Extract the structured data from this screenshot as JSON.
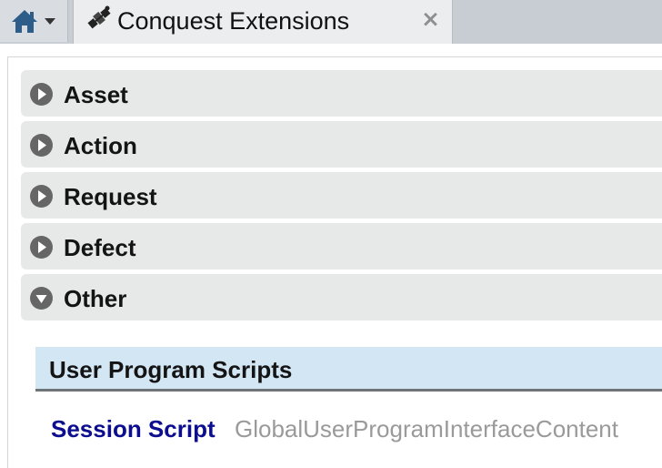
{
  "home": {
    "icon": "home-icon",
    "dropdown_icon": "caret-down-icon"
  },
  "tab": {
    "title": "Conquest Extensions",
    "icon": "satellite-icon",
    "close_label": "×"
  },
  "sections": [
    {
      "label": "Asset",
      "state": "collapsed"
    },
    {
      "label": "Action",
      "state": "collapsed"
    },
    {
      "label": "Request",
      "state": "collapsed"
    },
    {
      "label": "Defect",
      "state": "collapsed"
    },
    {
      "label": "Other",
      "state": "expanded"
    }
  ],
  "other": {
    "subpanel_title": "User Program Scripts",
    "session_script_label": "Session Script",
    "session_script_value": "GlobalUserProgramInterfaceContent"
  },
  "colors": {
    "tabbar_bg": "#c8cdd3",
    "section_bg": "#e7e8e8",
    "subpanel_bg": "#d3e6f3",
    "link_color": "#0d0d8f",
    "value_color": "#9a9a9a"
  }
}
